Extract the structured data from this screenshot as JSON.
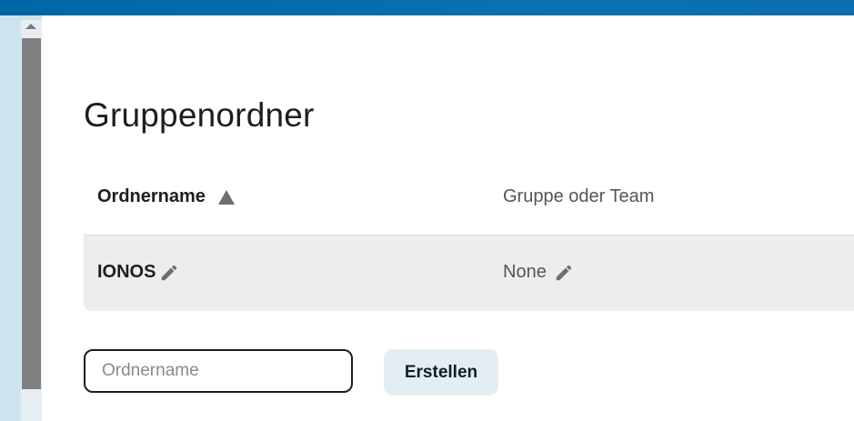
{
  "colors": {
    "topbar": "#0066a8",
    "sidebar": "#cde3ee",
    "row_background": "#ededed",
    "button_background": "#e3eef4"
  },
  "page": {
    "title": "Gruppenordner"
  },
  "table": {
    "columns": {
      "name": "Ordnername",
      "group": "Gruppe oder Team"
    },
    "sort_icon": "triangle-up-icon",
    "rows": [
      {
        "name": "IONOS",
        "group": "None",
        "edit_icon": "pencil-icon"
      }
    ]
  },
  "form": {
    "input_placeholder": "Ordnername",
    "input_value": "",
    "create_label": "Erstellen"
  }
}
